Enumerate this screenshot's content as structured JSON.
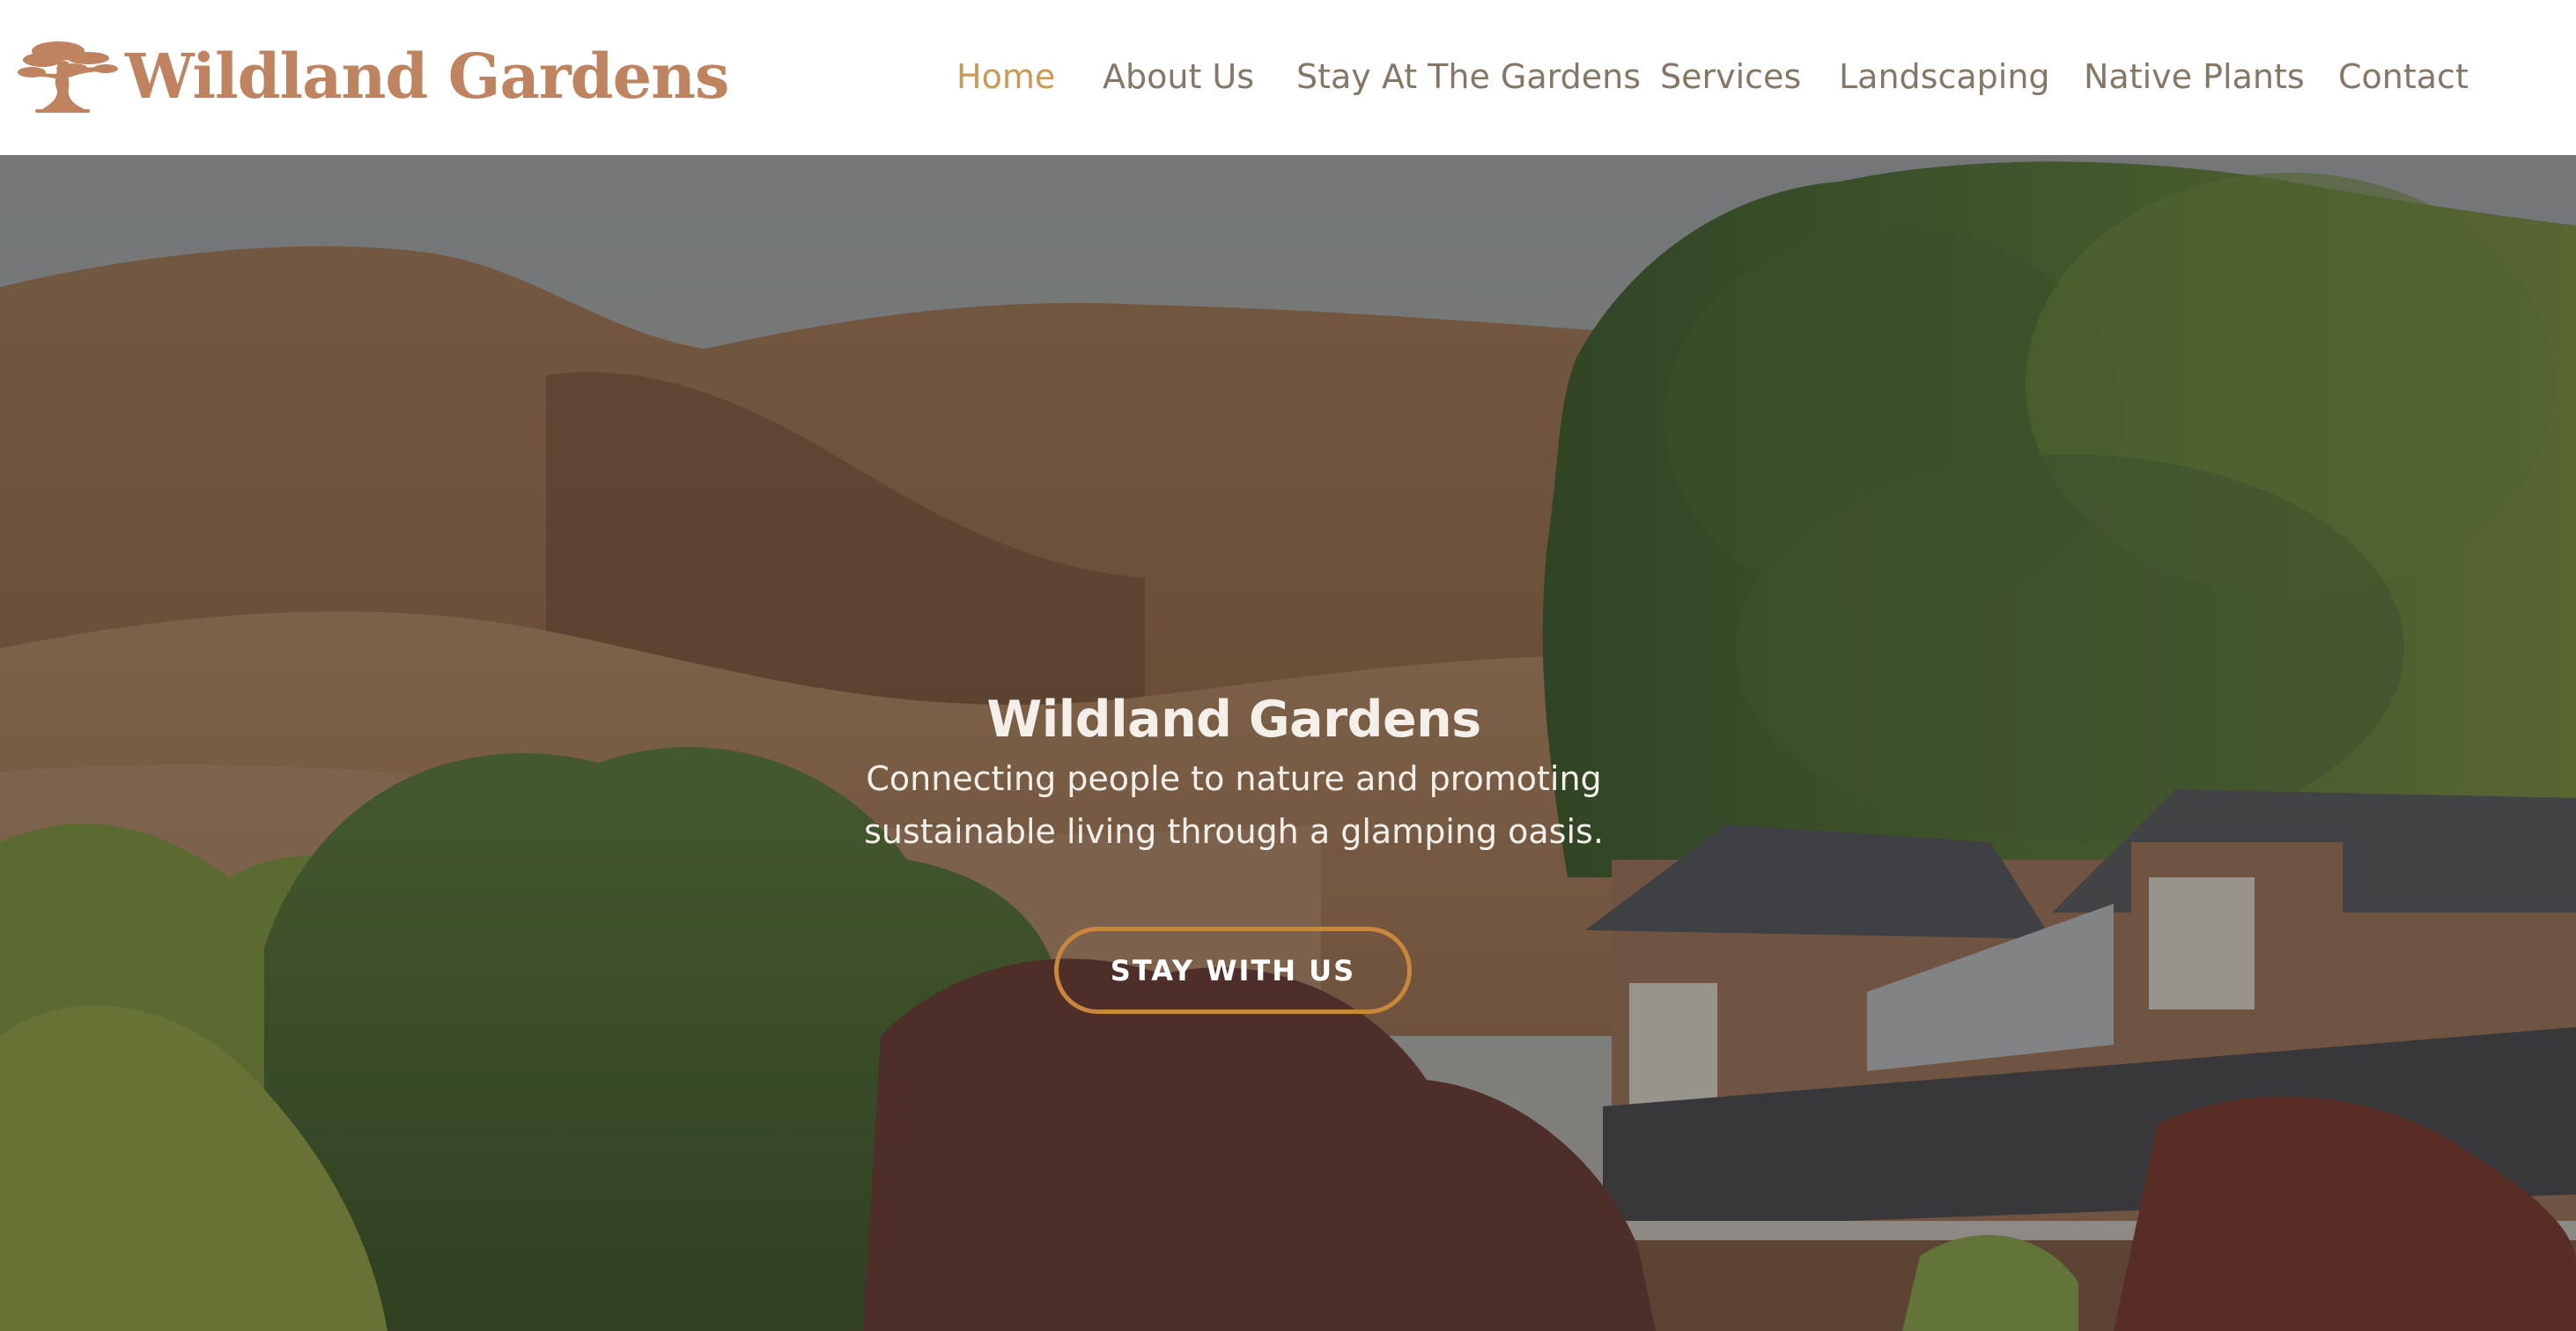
{
  "header": {
    "logo_text": "Wildland Gardens",
    "logo_icon": "bonsai-tree-icon",
    "nav": [
      {
        "label": "Home",
        "active": true
      },
      {
        "label": "About Us",
        "active": false
      },
      {
        "label": "Stay At The Gardens",
        "active": false
      },
      {
        "label": "Services",
        "active": false
      },
      {
        "label": "Landscaping",
        "active": false
      },
      {
        "label": "Native Plants",
        "active": false
      },
      {
        "label": "Contact",
        "active": false
      }
    ]
  },
  "hero": {
    "title": "Wildland Gardens",
    "subtitle": "Connecting people to nature and promoting sustainable living through a glamping oasis.",
    "cta_label": "STAY WITH US"
  },
  "colors": {
    "brand": "#bf8360",
    "nav_text": "#857766",
    "nav_active": "#c99a57",
    "cta_border": "#c9873b"
  }
}
